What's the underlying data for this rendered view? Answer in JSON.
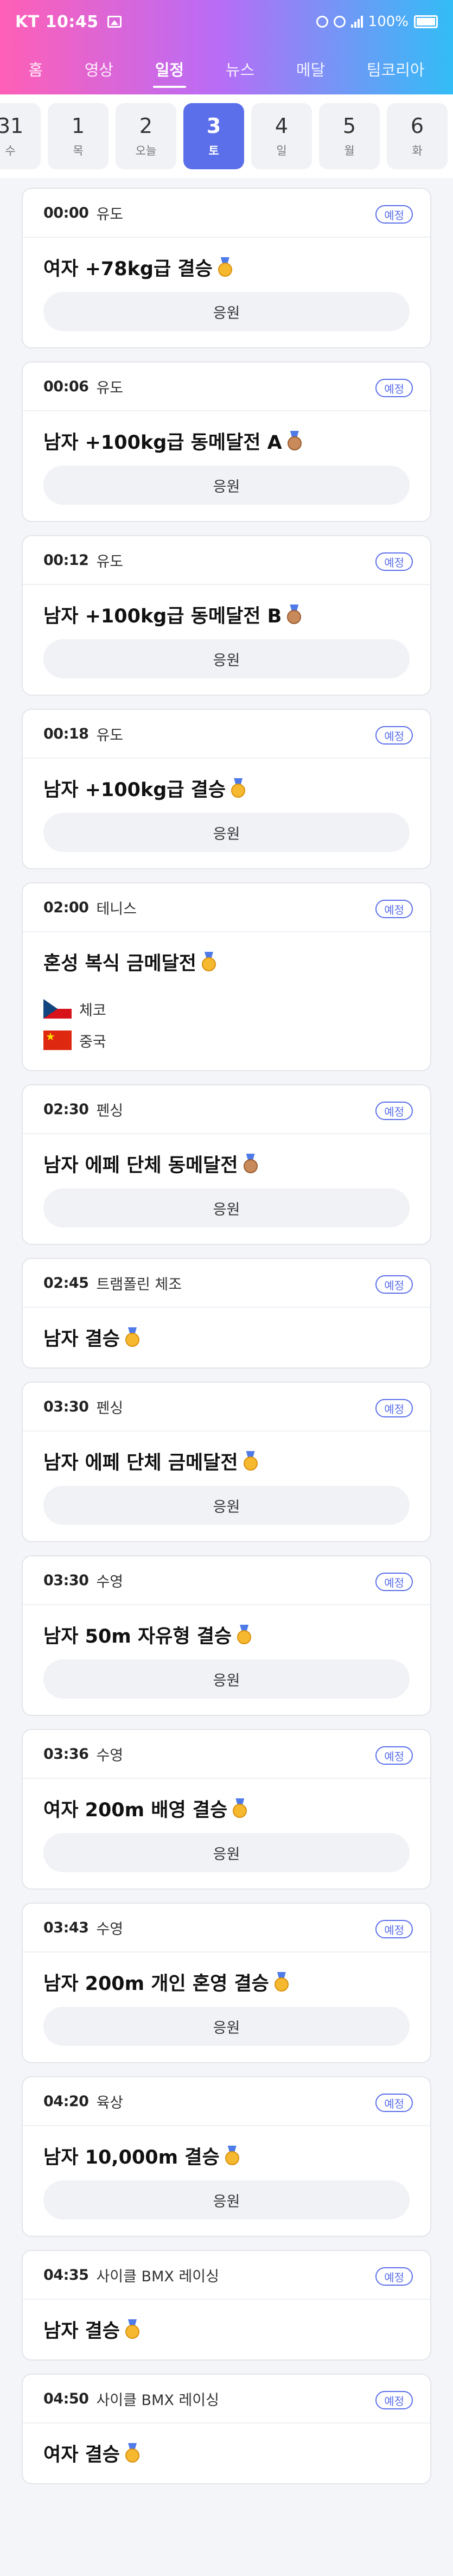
{
  "status": {
    "left": "KT 10:45",
    "battery": "100%"
  },
  "nav": [
    "홈",
    "영상",
    "일정",
    "뉴스",
    "메달",
    "팀코리아"
  ],
  "dates": [
    {
      "num": "31",
      "day": "수"
    },
    {
      "num": "1",
      "day": "목"
    },
    {
      "num": "2",
      "day": "오늘"
    },
    {
      "num": "3",
      "day": "토"
    },
    {
      "num": "4",
      "day": "일"
    },
    {
      "num": "5",
      "day": "월"
    },
    {
      "num": "6",
      "day": "화"
    }
  ],
  "badge_label": "예정",
  "cheer_label": "응원",
  "events": [
    {
      "time": "00:00",
      "sport": "유도",
      "title": "여자 +78kg급 결승",
      "medal": "gold",
      "cheer": true
    },
    {
      "time": "00:06",
      "sport": "유도",
      "title": "남자 +100kg급 동메달전 A",
      "medal": "bronze",
      "cheer": true
    },
    {
      "time": "00:12",
      "sport": "유도",
      "title": "남자 +100kg급 동메달전 B",
      "medal": "bronze",
      "cheer": true
    },
    {
      "time": "00:18",
      "sport": "유도",
      "title": "남자 +100kg급 결승",
      "medal": "gold",
      "cheer": true
    },
    {
      "time": "02:00",
      "sport": "테니스",
      "title": "혼성 복식 금메달전",
      "medal": "gold",
      "cheer": false,
      "teams": [
        {
          "flag": "cz",
          "name": "체코"
        },
        {
          "flag": "cn",
          "name": "중국"
        }
      ]
    },
    {
      "time": "02:30",
      "sport": "펜싱",
      "title": "남자 에페 단체 동메달전",
      "medal": "bronze",
      "cheer": true
    },
    {
      "time": "02:45",
      "sport": "트램폴린 체조",
      "title": "남자 결승",
      "medal": "gold",
      "cheer": false
    },
    {
      "time": "03:30",
      "sport": "펜싱",
      "title": "남자 에페 단체 금메달전",
      "medal": "gold",
      "cheer": true
    },
    {
      "time": "03:30",
      "sport": "수영",
      "title": "남자 50m 자유형 결승",
      "medal": "gold",
      "cheer": true
    },
    {
      "time": "03:36",
      "sport": "수영",
      "title": "여자 200m 배영 결승",
      "medal": "gold",
      "cheer": true
    },
    {
      "time": "03:43",
      "sport": "수영",
      "title": "남자 200m 개인 혼영 결승",
      "medal": "gold",
      "cheer": true
    },
    {
      "time": "04:20",
      "sport": "육상",
      "title": "남자 10,000m 결승",
      "medal": "gold",
      "cheer": true
    },
    {
      "time": "04:35",
      "sport": "사이클 BMX 레이싱",
      "title": "남자 결승",
      "medal": "gold",
      "cheer": false
    },
    {
      "time": "04:50",
      "sport": "사이클 BMX 레이싱",
      "title": "여자 결승",
      "medal": "gold",
      "cheer": false
    }
  ]
}
